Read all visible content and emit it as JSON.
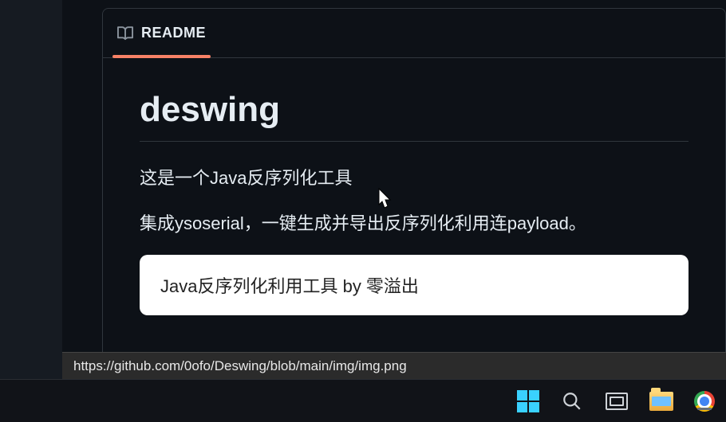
{
  "tab": {
    "label": "README"
  },
  "readme": {
    "title": "deswing",
    "p1": "这是一个Java反序列化工具",
    "p2": "集成ysoserial，一键生成并导出反序列化利用连payload。",
    "image_caption": "Java反序列化利用工具 by 零溢出"
  },
  "status": {
    "url": "https://github.com/0ofo/Deswing/blob/main/img/img.png"
  }
}
